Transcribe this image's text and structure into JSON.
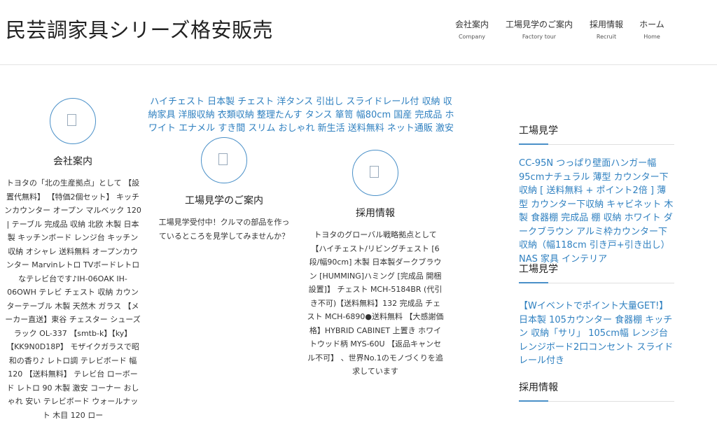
{
  "site": {
    "title": "民芸調家具シリーズ格安販売"
  },
  "nav": [
    {
      "label": "会社案内",
      "sub": "Company"
    },
    {
      "label": "工場見学のご案内",
      "sub": "Factory tour"
    },
    {
      "label": "採用情報",
      "sub": "Recruit"
    },
    {
      "label": "ホーム",
      "sub": "Home"
    }
  ],
  "featured": {
    "text": "ハイチェスト 日本製 チェスト 洋タンス 引出し スライドレール付 収納 収納家具 洋服収納 衣類収納 整理たんす タンス 箪笥 幅80cm 国産 完成品 ホワイト エナメル すき間 スリム おしゃれ 新生活 送料無料 ネット通販 激安"
  },
  "columns": [
    {
      "icon": "building-icon",
      "title": "会社案内",
      "text": "トヨタの「北の生産拠点」として 【設置代無料】 【特価2個セット】 キッチンカウンター オープン マルベック 120 | テーブル 完成品 収納 北欧 木製 日本製 キッチンボード レンジ台 キッチン収納 オシャレ 送料無料 オープンカウンター Marvinレトロ TVボードレトロなテレビ台です♪IH-06OAK IH-06OWH テレビ チェスト 収納 カウンターテーブル 木製 天然木 ガラス 【メーカー直送】東谷 チェスター シューズラック OL-337 【smtb-k】【ky】【KK9N0D18P】 モザイクガラスで昭和の香り♪ レトロ調 テレビボード 幅120 【送料無料】 テレビ台 ローボード レトロ 90 木製 激安 コーナー おしゃれ 安い テレビボード ウォールナット 木目 120 ロー"
    },
    {
      "icon": "factory-icon",
      "title": "工場見学のご案内",
      "text": "工場見学受付中！クルマの部品を作っているところを見学してみませんか？"
    },
    {
      "icon": "recruit-icon",
      "title": "採用情報",
      "text": "トヨタのグローバル戦略拠点として 【ハイチェスト/リビングチェスト [6段/幅90cm] 木製 日本製ダークブラウン [HUMMING]ハミング [完成品 開梱設置]】 チェスト MCH-5184BR (代引き不可)【送料無料】132 完成品 チェスト MCH-6890●送料無料 【大感謝価格】HYBRID CABINET 上置き ホワイトウッド柄 MYS-60U 【返品キャンセル不可】 、世界No.1のモノづくりを追求しています"
    }
  ],
  "sidebar": {
    "widgets": [
      {
        "title": "工場見学",
        "link": "CC-95N つっぱり壁面ハンガー幅95cmナチュラル 薄型 カウンター下収納 [ 送料無料 + ポイント2倍 ] 薄型 カウンター下収納 キャビネット 木製 食器棚 完成品 棚 収納 ホワイト ダークブラウン アルミ枠カウンター下収納（幅118cm 引き戸+引き出し）NAS 家具 インテリア"
      },
      {
        "title": "工場見学",
        "link": "【Wイベントでポイント大量GET!】 日本製 105カウンター 食器棚 キッチン 収納「サリ」 105cm幅 レンジ台 レンジボード2口コンセント スライドレール付き"
      },
      {
        "title": "採用情報",
        "link": ""
      }
    ]
  },
  "colors": {
    "accent": "#4a90c8",
    "link": "#2f80c0",
    "text": "#333333"
  }
}
